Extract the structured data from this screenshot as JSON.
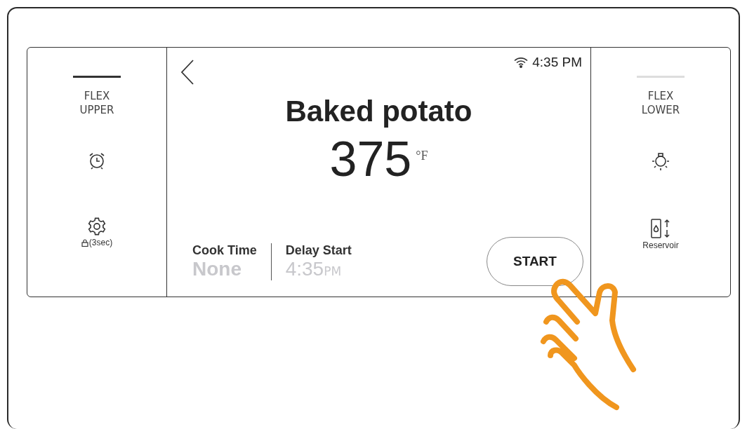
{
  "side_left": {
    "zone": {
      "label": "FLEX UPPER",
      "selected": true
    },
    "buttons": [
      {
        "kind": "timer"
      },
      {
        "kind": "settings",
        "caption": "(3sec)"
      }
    ]
  },
  "side_right": {
    "zone": {
      "label": "FLEX LOWER",
      "selected": false
    },
    "buttons": [
      {
        "kind": "light"
      },
      {
        "kind": "reservoir",
        "caption": "Reservoir"
      }
    ]
  },
  "status": {
    "time": "4:35 PM"
  },
  "title": "Baked potato",
  "temperature": {
    "value": "375",
    "unit": "°F"
  },
  "options": [
    {
      "label": "Cook Time",
      "value": "None",
      "disabled": true
    },
    {
      "label": "Delay Start",
      "value": "4:35",
      "suffix": "PM",
      "disabled": true
    }
  ],
  "start_button": "START"
}
